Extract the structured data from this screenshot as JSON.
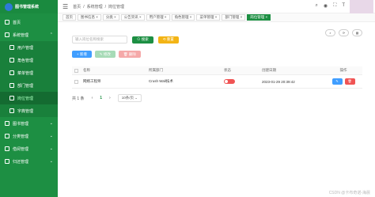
{
  "app": {
    "title": "图书管理系统"
  },
  "sidebar": {
    "items": [
      {
        "label": "首页",
        "arrow": ""
      },
      {
        "label": "系统管理",
        "arrow": "⌃"
      },
      {
        "label": "用户管理",
        "arrow": ""
      },
      {
        "label": "角色管理",
        "arrow": ""
      },
      {
        "label": "菜单管理",
        "arrow": ""
      },
      {
        "label": "部门管理",
        "arrow": ""
      },
      {
        "label": "岗位管理",
        "arrow": ""
      },
      {
        "label": "字典管理",
        "arrow": ""
      },
      {
        "label": "图书管理",
        "arrow": "⌄"
      },
      {
        "label": "分类管理",
        "arrow": "⌄"
      },
      {
        "label": "借阅管理",
        "arrow": "⌄"
      },
      {
        "label": "归还管理",
        "arrow": "⌄"
      }
    ]
  },
  "header": {
    "breadcrumb": [
      "首页",
      "/",
      "系统管理",
      "/",
      "岗位管理"
    ]
  },
  "tags": [
    "首页",
    "图书信息 ×",
    "分类 ×",
    "公告资讯 ×",
    "用户管理 ×",
    "角色管理 ×",
    "菜单管理 ×",
    "部门管理 ×",
    "岗位管理 ×"
  ],
  "search": {
    "placeholder": "输入岗位名称搜索",
    "search_label": "⊙ 搜索",
    "reset_label": "⟲ 重置"
  },
  "actions": {
    "add": "+ 新增",
    "edit": "✎ 修改",
    "delete": "🗑 删除"
  },
  "tools": [
    "⌕",
    "⟳",
    "▦"
  ],
  "table": {
    "headers": [
      "名称",
      "所属部门",
      "状态",
      "创建日期",
      "操作"
    ],
    "rows": [
      {
        "name": "网络工程师",
        "dept": "Crush Wall技术",
        "time": "2023-01-29 20:39:42"
      }
    ]
  },
  "pager": {
    "total": "共 1 条",
    "prev": "‹",
    "page": "1",
    "next": "›",
    "size": "10条/页 ⌄"
  },
  "watermark": "CSDN @卡布奇诺-海晨"
}
